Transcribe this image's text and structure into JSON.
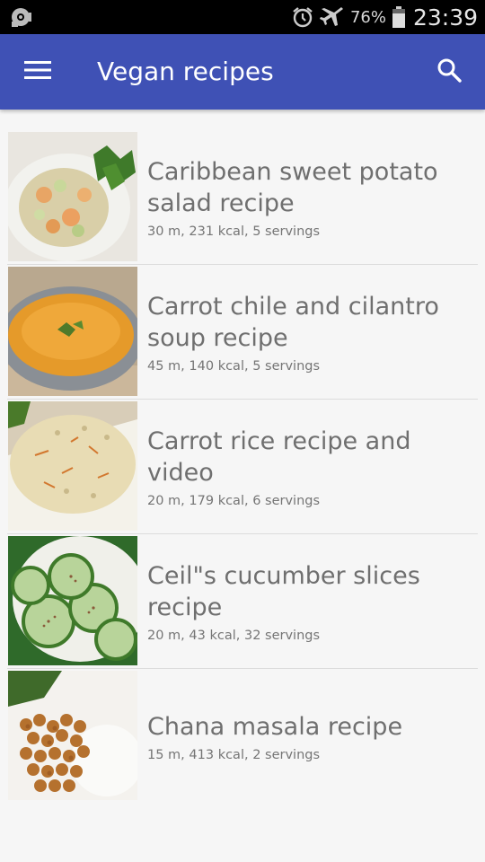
{
  "status_bar": {
    "battery_percent": "76%",
    "time": "23:39",
    "icons": [
      "camera-sync-icon",
      "alarm-icon",
      "airplane-mode-icon",
      "battery-icon"
    ]
  },
  "app_bar": {
    "title": "Vegan recipes",
    "menu_icon": "hamburger-menu-icon",
    "search_icon": "search-icon",
    "color": "#3f51b5"
  },
  "recipes": [
    {
      "title": "Caribbean sweet potato salad recipe",
      "meta": "30 m, 231 kcal, 5 servings",
      "image": "sweet-potato-salad-photo"
    },
    {
      "title": "Carrot chile and cilantro soup recipe",
      "meta": "45 m, 140 kcal, 5 servings",
      "image": "carrot-soup-photo"
    },
    {
      "title": "Carrot rice recipe and video",
      "meta": "20 m, 179 kcal, 6 servings",
      "image": "carrot-rice-photo"
    },
    {
      "title": "Ceil\"s cucumber slices recipe",
      "meta": "20 m, 43 kcal, 32 servings",
      "image": "cucumber-slices-photo"
    },
    {
      "title": "Chana masala  recipe",
      "meta": "15 m, 413 kcal, 2 servings",
      "image": "chana-masala-photo"
    }
  ]
}
